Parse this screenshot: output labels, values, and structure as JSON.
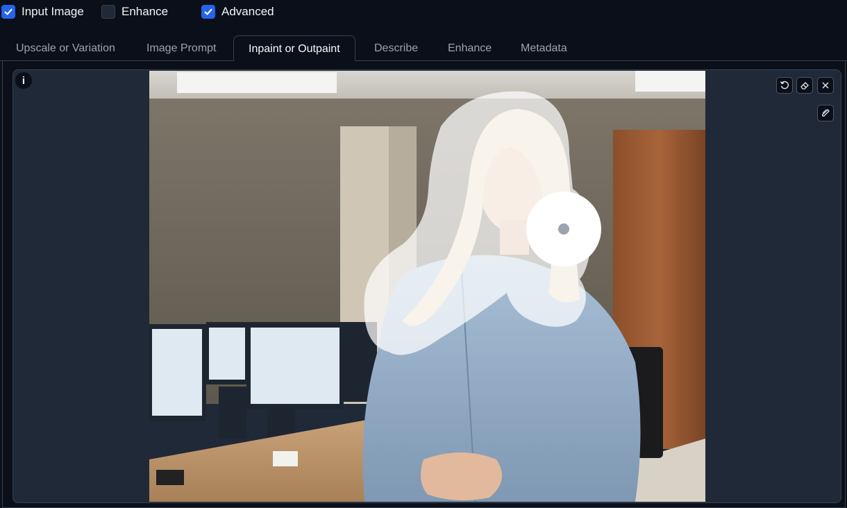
{
  "checkboxes": [
    {
      "label": "Input Image",
      "checked": true
    },
    {
      "label": "Enhance",
      "checked": false
    },
    {
      "label": "Advanced",
      "checked": true
    }
  ],
  "tabs": [
    {
      "label": "Upscale or Variation",
      "active": false
    },
    {
      "label": "Image Prompt",
      "active": false
    },
    {
      "label": "Inpaint or Outpaint",
      "active": true
    },
    {
      "label": "Describe",
      "active": false
    },
    {
      "label": "Enhance",
      "active": false
    },
    {
      "label": "Metadata",
      "active": false
    }
  ],
  "canvas": {
    "info_glyph": "i",
    "toolbar_icons": [
      "undo-icon",
      "eraser-icon",
      "close-icon",
      "brush-icon"
    ],
    "image_subject": "photo-of-woman-in-office-with-white-inpaint-mask"
  },
  "colors": {
    "background": "#0b0f19",
    "accent": "#2563eb",
    "panel": "#1f2937",
    "mask": "#ffffff"
  }
}
